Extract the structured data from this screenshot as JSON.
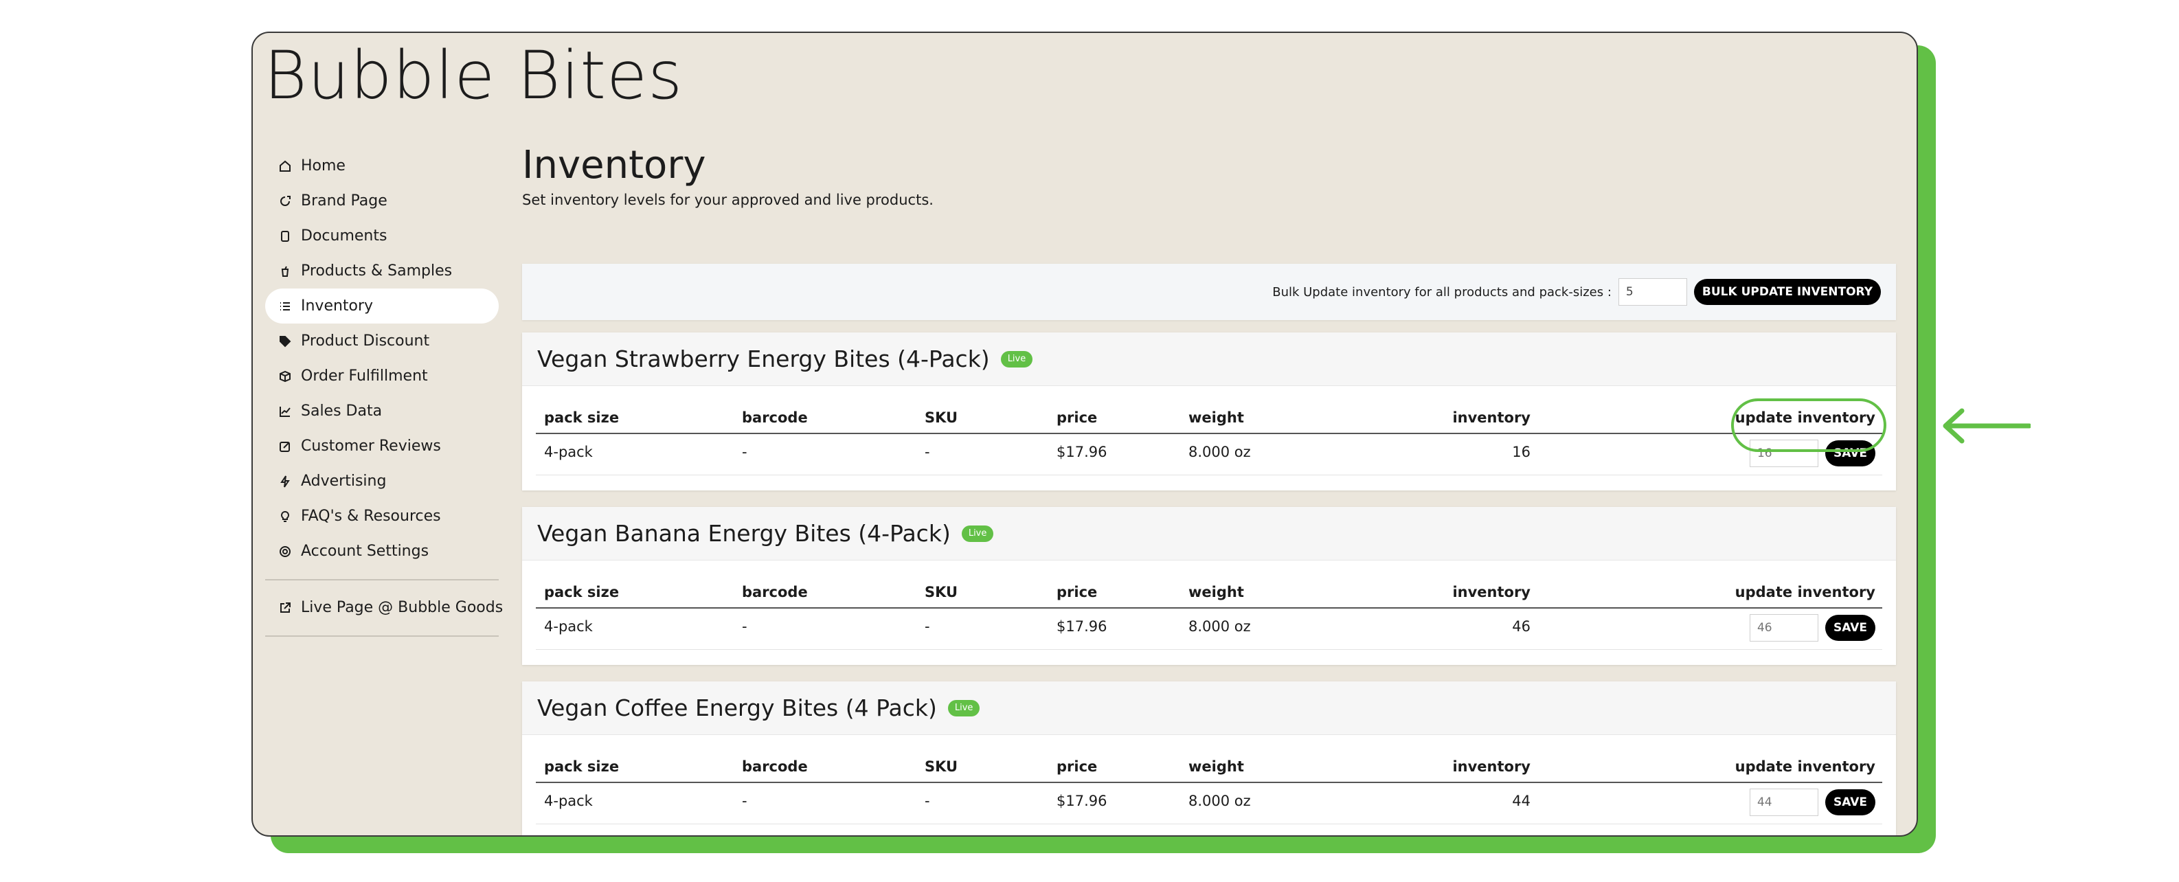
{
  "app": {
    "title": "Bubble Bites",
    "accent_color": "#62c046"
  },
  "sidebar": {
    "items": [
      {
        "label": "Home",
        "icon": "home-icon"
      },
      {
        "label": "Brand Page",
        "icon": "brand-page-icon"
      },
      {
        "label": "Documents",
        "icon": "documents-icon"
      },
      {
        "label": "Products & Samples",
        "icon": "products-icon"
      },
      {
        "label": "Inventory",
        "icon": "list-icon",
        "active": true
      },
      {
        "label": "Product Discount",
        "icon": "tag-icon"
      },
      {
        "label": "Order Fulfillment",
        "icon": "box-icon"
      },
      {
        "label": "Sales Data",
        "icon": "chart-icon"
      },
      {
        "label": "Customer Reviews",
        "icon": "edit-icon"
      },
      {
        "label": "Advertising",
        "icon": "bolt-icon"
      },
      {
        "label": "FAQ's & Resources",
        "icon": "lightbulb-icon"
      },
      {
        "label": "Account Settings",
        "icon": "gear-icon"
      }
    ],
    "external_link": {
      "label": "Live Page @ Bubble Goods",
      "icon": "external-link-icon"
    }
  },
  "main": {
    "title": "Inventory",
    "subtitle": "Set inventory levels for your approved and live products.",
    "bulk": {
      "label": "Bulk Update inventory for all products and pack-sizes :",
      "value": "5",
      "button_label": "BULK UPDATE INVENTORY"
    },
    "columns": {
      "pack_size": "pack size",
      "barcode": "barcode",
      "sku": "SKU",
      "price": "price",
      "weight": "weight",
      "inventory": "inventory",
      "update_inventory": "update inventory"
    },
    "products": [
      {
        "name": "Vegan Strawberry Energy Bites (4-Pack)",
        "badge": "Live",
        "row": {
          "pack_size": "4-pack",
          "barcode": "-",
          "sku": "-",
          "price": "$17.96",
          "weight": "8.000 oz",
          "inventory": "16",
          "update_placeholder": "16",
          "save_label": "SAVE"
        }
      },
      {
        "name": "Vegan Banana Energy Bites (4-Pack)",
        "badge": "Live",
        "row": {
          "pack_size": "4-pack",
          "barcode": "-",
          "sku": "-",
          "price": "$17.96",
          "weight": "8.000 oz",
          "inventory": "46",
          "update_placeholder": "46",
          "save_label": "SAVE"
        }
      },
      {
        "name": "Vegan Coffee Energy Bites (4 Pack)",
        "badge": "Live",
        "row": {
          "pack_size": "4-pack",
          "barcode": "-",
          "sku": "-",
          "price": "$17.96",
          "weight": "8.000 oz",
          "inventory": "44",
          "update_placeholder": "44",
          "save_label": "SAVE"
        }
      }
    ]
  }
}
